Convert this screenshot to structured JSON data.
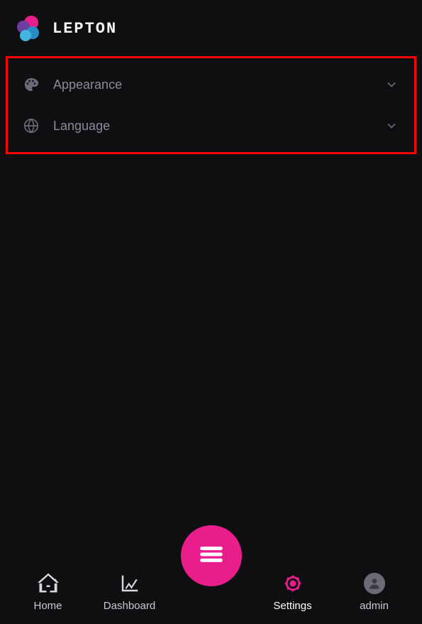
{
  "header": {
    "app_name": "LEPTON"
  },
  "settings": {
    "items": [
      {
        "label": "Appearance",
        "icon": "palette"
      },
      {
        "label": "Language",
        "icon": "globe"
      }
    ]
  },
  "nav": {
    "items": [
      {
        "label": "Home",
        "active": false
      },
      {
        "label": "Dashboard",
        "active": false
      },
      {
        "label": "Settings",
        "active": true
      },
      {
        "label": "admin",
        "active": false
      }
    ]
  }
}
